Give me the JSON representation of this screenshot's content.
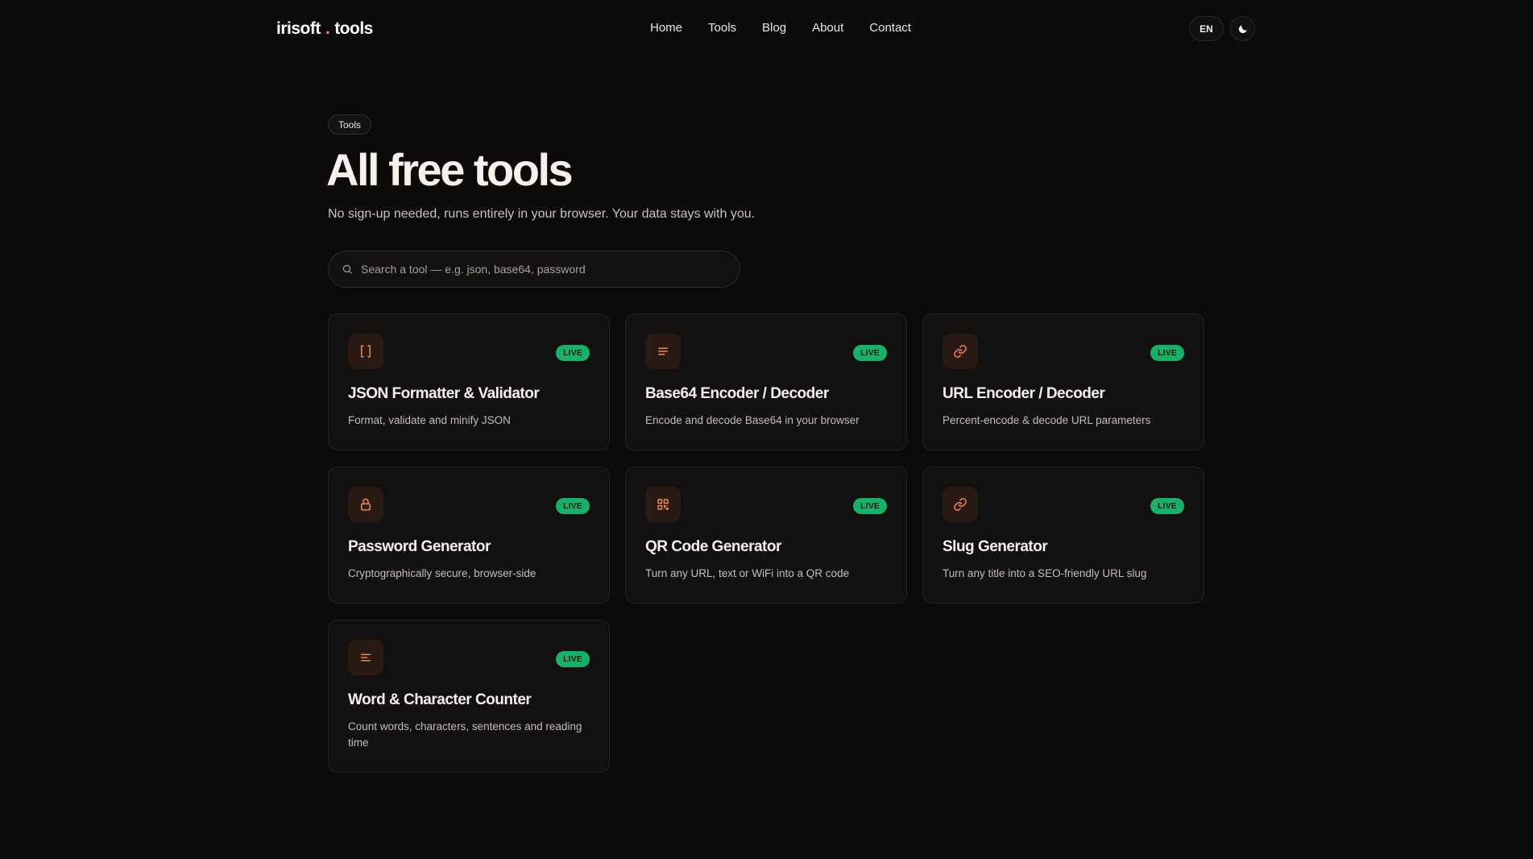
{
  "brand": {
    "left": "irisoft",
    "dot": ".",
    "right": "tools"
  },
  "nav": [
    {
      "label": "Home"
    },
    {
      "label": "Tools"
    },
    {
      "label": "Blog"
    },
    {
      "label": "About"
    },
    {
      "label": "Contact"
    }
  ],
  "header": {
    "language": "EN",
    "theme_icon": "moon-icon"
  },
  "breadcrumb": "Tools",
  "page": {
    "title": "All free tools",
    "subtitle": "No sign-up needed, runs entirely in your browser. Your data stays with you."
  },
  "search": {
    "placeholder": "Search a tool — e.g. json, base64, password",
    "value": ""
  },
  "colors": {
    "accent": "#f08a4b",
    "badge": "#17b26a",
    "background": "#0c0b0a"
  },
  "tools": [
    {
      "title": "JSON Formatter & Validator",
      "desc": "Format, validate and minify JSON",
      "badge": "LIVE",
      "icon": "brackets-icon"
    },
    {
      "title": "Base64 Encoder / Decoder",
      "desc": "Encode and decode Base64 in your browser",
      "badge": "LIVE",
      "icon": "lines-icon"
    },
    {
      "title": "URL Encoder / Decoder",
      "desc": "Percent-encode & decode URL parameters",
      "badge": "LIVE",
      "icon": "link-icon"
    },
    {
      "title": "Password Generator",
      "desc": "Cryptographically secure, browser-side",
      "badge": "LIVE",
      "icon": "lock-icon"
    },
    {
      "title": "QR Code Generator",
      "desc": "Turn any URL, text or WiFi into a QR code",
      "badge": "LIVE",
      "icon": "qr-code-icon"
    },
    {
      "title": "Slug Generator",
      "desc": "Turn any title into a SEO-friendly URL slug",
      "badge": "LIVE",
      "icon": "link-icon"
    },
    {
      "title": "Word & Character Counter",
      "desc": "Count words, characters, sentences and reading time",
      "badge": "LIVE",
      "icon": "text-align-icon"
    }
  ]
}
